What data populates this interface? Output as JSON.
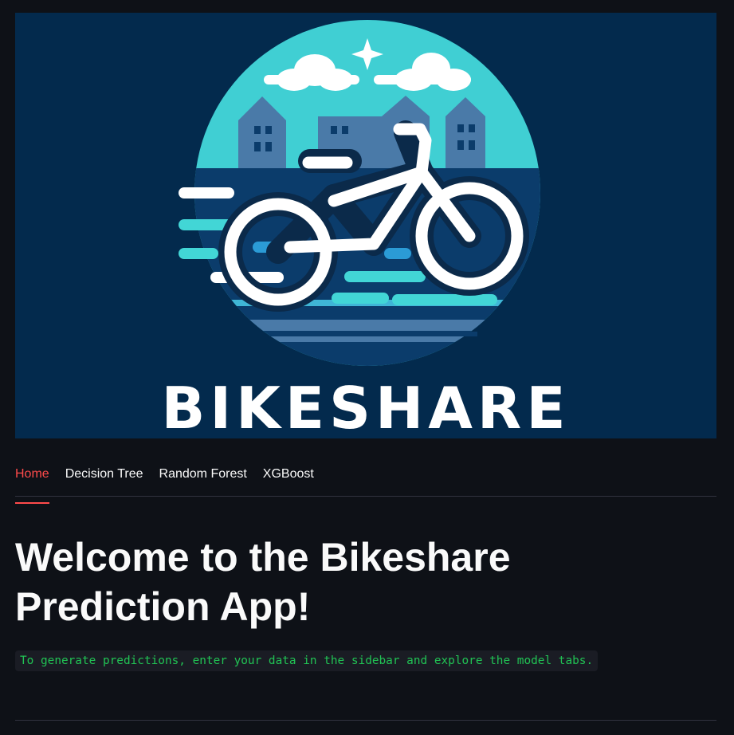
{
  "banner": {
    "wordmark": "BIKESHARE",
    "colors": {
      "background": "#032a4d",
      "circle": "#42d6d6",
      "buildings": "#4a7aa8",
      "bike": "#ffffff",
      "accent": "#2b9bd6"
    }
  },
  "tabs": [
    {
      "label": "Home",
      "active": true
    },
    {
      "label": "Decision Tree",
      "active": false
    },
    {
      "label": "Random Forest",
      "active": false
    },
    {
      "label": "XGBoost",
      "active": false
    }
  ],
  "main": {
    "title": "Welcome to the Bikeshare Prediction App!",
    "note": "To generate predictions, enter your data in the sidebar and explore the model tabs."
  },
  "theme": {
    "background": "#0e1117",
    "text": "#fafafa",
    "accent": "#ff4b4b",
    "code_text": "#21c354"
  }
}
